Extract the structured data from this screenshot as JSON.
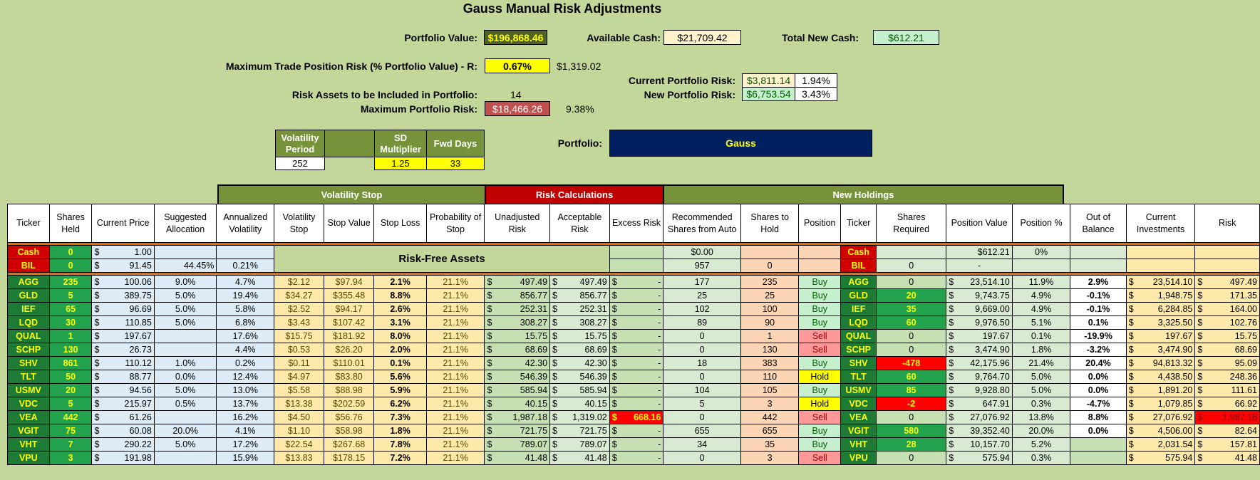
{
  "title": "Gauss Manual Risk Adjustments",
  "summary": {
    "portfolio_value_label": "Portfolio Value:",
    "portfolio_value": "$196,868.46",
    "available_cash_label": "Available Cash:",
    "available_cash": "$21,709.42",
    "total_new_cash_label": "Total New Cash:",
    "total_new_cash": "$612.21",
    "max_trade_risk_label": "Maximum Trade Position Risk (% Portfolio Value) - R:",
    "max_trade_risk_pct": "0.67%",
    "max_trade_risk_value": "$1,319.02",
    "risk_assets_label": "Risk Assets to be Included in Portfolio:",
    "risk_assets_count": "14",
    "max_portfolio_risk_label": "Maximum Portfolio Risk:",
    "max_portfolio_risk": "$18,466.26",
    "max_portfolio_risk_pct": "9.38%",
    "current_risk_label": "Current Portfolio Risk:",
    "current_risk_value": "$3,811.14",
    "current_risk_pct": "1.94%",
    "new_risk_label": "New Portfolio Risk:",
    "new_risk_value": "$6,753.54",
    "new_risk_pct": "3.43%"
  },
  "params": {
    "vol_period_label": "Volatility Period",
    "vol_period": "252",
    "sd_mult_label": "SD Multiplier",
    "sd_mult": "1.25",
    "fwd_days_label": "Fwd Days",
    "fwd_days": "33",
    "portfolio_label": "Portfolio:",
    "portfolio_name": "Gauss"
  },
  "sections": {
    "volatility_stop": "Volatility Stop",
    "risk_calculations": "Risk Calculations",
    "new_holdings": "New Holdings",
    "risk_free": "Risk-Free Assets"
  },
  "columns": [
    "Ticker",
    "Shares Held",
    "Current Price",
    "Suggested Allocation",
    "Annualized Volatility",
    "Volatility Stop",
    "Stop Value",
    "Stop Loss",
    "Probability of Stop",
    "Unadjusted Risk",
    "Acceptable Risk",
    "Excess Risk",
    "Recommended Shares from Auto",
    "Shares to Hold",
    "Position",
    "Ticker",
    "Shares Required",
    "Position Value",
    "Position %",
    "Out of Balance",
    "Current Investments",
    "Risk"
  ],
  "risk_free_rows": [
    {
      "ticker": "Cash",
      "held": "0",
      "price": "1.00",
      "alloc": "",
      "vol": "",
      "rec": "$0.00",
      "hold": "",
      "ticker2": "Cash",
      "req": "",
      "pval": "$612.21",
      "ppct": "0%"
    },
    {
      "ticker": "BIL",
      "held": "0",
      "price": "91.45",
      "alloc": "44.45%",
      "vol": "0.21%",
      "rec": "957",
      "hold": "0",
      "ticker2": "BIL",
      "req": "0",
      "pval": "-",
      "ppct": ""
    }
  ],
  "rows": [
    {
      "ticker": "AGG",
      "held": "235",
      "price": "100.06",
      "alloc": "9.0%",
      "vol": "4.7%",
      "vstop": "$2.12",
      "sval": "$97.94",
      "sloss": "2.1%",
      "prob": "21.1%",
      "unadj": "497.49",
      "acc": "497.49",
      "excess": "-",
      "rec": "177",
      "hold": "235",
      "pos": "Buy",
      "req": "0",
      "pval": "23,514.10",
      "ppct": "11.9%",
      "oob": "2.9%",
      "cur": "23,514.10",
      "risk": "497.49"
    },
    {
      "ticker": "GLD",
      "held": "5",
      "price": "389.75",
      "alloc": "5.0%",
      "vol": "19.4%",
      "vstop": "$34.27",
      "sval": "$355.48",
      "sloss": "8.8%",
      "prob": "21.1%",
      "unadj": "856.77",
      "acc": "856.77",
      "excess": "-",
      "rec": "25",
      "hold": "25",
      "pos": "Buy",
      "req": "20",
      "pval": "9,743.75",
      "ppct": "4.9%",
      "oob": "-0.1%",
      "cur": "1,948.75",
      "risk": "171.35"
    },
    {
      "ticker": "IEF",
      "held": "65",
      "price": "96.69",
      "alloc": "5.0%",
      "vol": "5.8%",
      "vstop": "$2.52",
      "sval": "$94.17",
      "sloss": "2.6%",
      "prob": "21.1%",
      "unadj": "252.31",
      "acc": "252.31",
      "excess": "-",
      "rec": "102",
      "hold": "100",
      "pos": "Buy",
      "req": "35",
      "pval": "9,669.00",
      "ppct": "4.9%",
      "oob": "-0.1%",
      "cur": "6,284.85",
      "risk": "164.00"
    },
    {
      "ticker": "LQD",
      "held": "30",
      "price": "110.85",
      "alloc": "5.0%",
      "vol": "6.8%",
      "vstop": "$3.43",
      "sval": "$107.42",
      "sloss": "3.1%",
      "prob": "21.1%",
      "unadj": "308.27",
      "acc": "308.27",
      "excess": "-",
      "rec": "89",
      "hold": "90",
      "pos": "Buy",
      "req": "60",
      "pval": "9,976.50",
      "ppct": "5.1%",
      "oob": "0.1%",
      "cur": "3,325.50",
      "risk": "102.76"
    },
    {
      "ticker": "QUAL",
      "held": "1",
      "price": "197.67",
      "alloc": "",
      "vol": "17.6%",
      "vstop": "$15.75",
      "sval": "$181.92",
      "sloss": "8.0%",
      "prob": "21.1%",
      "unadj": "15.75",
      "acc": "15.75",
      "excess": "-",
      "rec": "0",
      "hold": "1",
      "pos": "Sell",
      "req": "0",
      "pval": "197.67",
      "ppct": "0.1%",
      "oob": "-19.9%",
      "cur": "197.67",
      "risk": "15.75"
    },
    {
      "ticker": "SCHP",
      "held": "130",
      "price": "26.73",
      "alloc": "",
      "vol": "4.4%",
      "vstop": "$0.53",
      "sval": "$26.20",
      "sloss": "2.0%",
      "prob": "21.1%",
      "unadj": "68.69",
      "acc": "68.69",
      "excess": "-",
      "rec": "0",
      "hold": "130",
      "pos": "Sell",
      "req": "0",
      "pval": "3,474.90",
      "ppct": "1.8%",
      "oob": "-3.2%",
      "cur": "3,474.90",
      "risk": "68.69"
    },
    {
      "ticker": "SHV",
      "held": "861",
      "price": "110.12",
      "alloc": "1.0%",
      "vol": "0.2%",
      "vstop": "$0.11",
      "sval": "$110.01",
      "sloss": "0.1%",
      "prob": "21.1%",
      "unadj": "42.30",
      "acc": "42.30",
      "excess": "-",
      "rec": "18",
      "hold": "383",
      "pos": "Buy",
      "req": "-478",
      "pval": "42,175.96",
      "ppct": "21.4%",
      "oob": "20.4%",
      "cur": "94,813.32",
      "risk": "95.09"
    },
    {
      "ticker": "TLT",
      "held": "50",
      "price": "88.77",
      "alloc": "0.0%",
      "vol": "12.4%",
      "vstop": "$4.97",
      "sval": "$83.80",
      "sloss": "5.6%",
      "prob": "21.1%",
      "unadj": "546.39",
      "acc": "546.39",
      "excess": "-",
      "rec": "0",
      "hold": "110",
      "pos": "Hold",
      "req": "60",
      "pval": "9,764.70",
      "ppct": "5.0%",
      "oob": "0.0%",
      "cur": "4,438.50",
      "risk": "248.36"
    },
    {
      "ticker": "USMV",
      "held": "20",
      "price": "94.56",
      "alloc": "5.0%",
      "vol": "13.0%",
      "vstop": "$5.58",
      "sval": "$88.98",
      "sloss": "5.9%",
      "prob": "21.1%",
      "unadj": "585.94",
      "acc": "585.94",
      "excess": "-",
      "rec": "104",
      "hold": "105",
      "pos": "Buy",
      "req": "85",
      "pval": "9,928.80",
      "ppct": "5.0%",
      "oob": "0.0%",
      "cur": "1,891.20",
      "risk": "111.61"
    },
    {
      "ticker": "VDC",
      "held": "5",
      "price": "215.97",
      "alloc": "0.5%",
      "vol": "13.7%",
      "vstop": "$13.38",
      "sval": "$202.59",
      "sloss": "6.2%",
      "prob": "21.1%",
      "unadj": "40.15",
      "acc": "40.15",
      "excess": "-",
      "rec": "5",
      "hold": "3",
      "pos": "Hold",
      "req": "-2",
      "pval": "647.91",
      "ppct": "0.3%",
      "oob": "-4.7%",
      "cur": "1,079.85",
      "risk": "66.92"
    },
    {
      "ticker": "VEA",
      "held": "442",
      "price": "61.26",
      "alloc": "",
      "vol": "16.2%",
      "vstop": "$4.50",
      "sval": "$56.76",
      "sloss": "7.3%",
      "prob": "21.1%",
      "unadj": "1,987.18",
      "acc": "1,319.02",
      "excess": "668.16",
      "rec": "0",
      "hold": "442",
      "pos": "Sell",
      "req": "0",
      "pval": "27,076.92",
      "ppct": "13.8%",
      "oob": "8.8%",
      "cur": "27,076.92",
      "risk": "1,987.18"
    },
    {
      "ticker": "VGIT",
      "held": "75",
      "price": "60.08",
      "alloc": "20.0%",
      "vol": "4.1%",
      "vstop": "$1.10",
      "sval": "$58.98",
      "sloss": "1.8%",
      "prob": "21.1%",
      "unadj": "721.75",
      "acc": "721.75",
      "excess": "-",
      "rec": "655",
      "hold": "655",
      "pos": "Buy",
      "req": "580",
      "pval": "39,352.40",
      "ppct": "20.0%",
      "oob": "0.0%",
      "cur": "4,506.00",
      "risk": "82.64"
    },
    {
      "ticker": "VHT",
      "held": "7",
      "price": "290.22",
      "alloc": "5.0%",
      "vol": "17.2%",
      "vstop": "$22.54",
      "sval": "$267.68",
      "sloss": "7.8%",
      "prob": "21.1%",
      "unadj": "789.07",
      "acc": "789.07",
      "excess": "-",
      "rec": "34",
      "hold": "35",
      "pos": "Buy",
      "req": "28",
      "pval": "10,157.70",
      "ppct": "5.2%",
      "oob": "",
      "cur": "2,031.54",
      "risk": "157.81"
    },
    {
      "ticker": "VPU",
      "held": "3",
      "price": "191.98",
      "alloc": "",
      "vol": "15.9%",
      "vstop": "$13.83",
      "sval": "$178.15",
      "sloss": "7.2%",
      "prob": "21.1%",
      "unadj": "41.48",
      "acc": "41.48",
      "excess": "-",
      "rec": "0",
      "hold": "3",
      "pos": "Sell",
      "req": "0",
      "pval": "575.94",
      "ppct": "0.3%",
      "oob": "",
      "cur": "575.94",
      "risk": "41.48"
    }
  ],
  "colors": {
    "background": "#c4d79b",
    "ticker_green": "#1e7b36",
    "ticker_yellow": "#ffff00",
    "cash_red": "#d00000",
    "navy": "#002060",
    "olive": "#76933c"
  }
}
